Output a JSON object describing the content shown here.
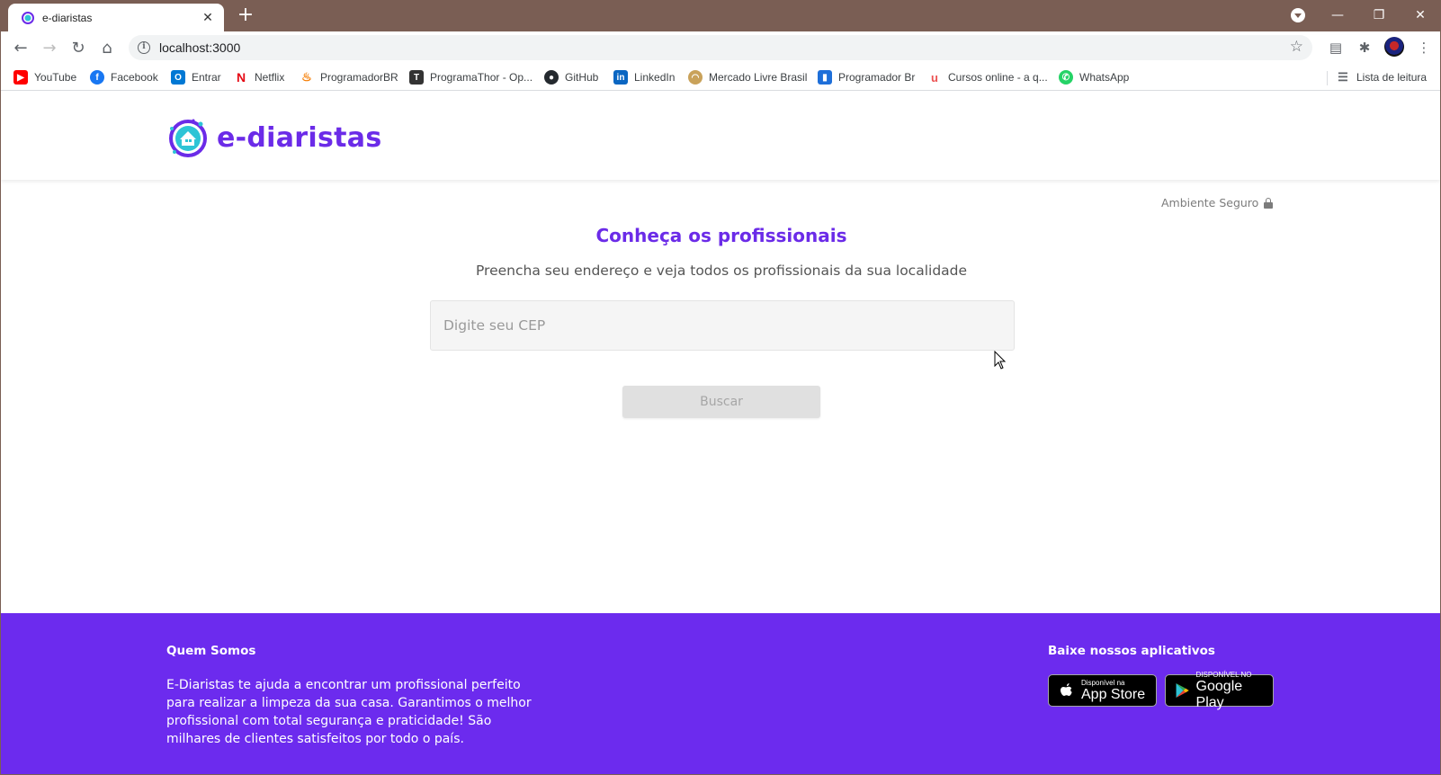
{
  "browser": {
    "tab_title": "e-diaristas",
    "url": "localhost:3000",
    "bookmarks": [
      {
        "label": "YouTube",
        "icon": "youtube-icon",
        "color": "#ff0000"
      },
      {
        "label": "Facebook",
        "icon": "facebook-icon",
        "color": "#1877f2"
      },
      {
        "label": "Entrar",
        "icon": "outlook-icon",
        "color": "#0078d4"
      },
      {
        "label": "Netflix",
        "icon": "netflix-icon",
        "color": "#e50914"
      },
      {
        "label": "ProgramadorBR",
        "icon": "flame-icon",
        "color": "#f57c00"
      },
      {
        "label": "ProgramaThor - Op...",
        "icon": "programathor-icon",
        "color": "#333333"
      },
      {
        "label": "GitHub",
        "icon": "github-icon",
        "color": "#24292e"
      },
      {
        "label": "LinkedIn",
        "icon": "linkedin-icon",
        "color": "#0a66c2"
      },
      {
        "label": "Mercado Livre Brasil",
        "icon": "mercadolivre-icon",
        "color": "#c9a25a"
      },
      {
        "label": "Programador Br",
        "icon": "programadorbr-icon",
        "color": "#1e6fd9"
      },
      {
        "label": "Cursos online - a q...",
        "icon": "udemy-icon",
        "color": "#ec5252"
      },
      {
        "label": "WhatsApp",
        "icon": "whatsapp-icon",
        "color": "#25d366"
      }
    ],
    "reading_list_label": "Lista de leitura"
  },
  "site": {
    "logo_text": "e-diaristas",
    "brand_color": "#6b2be8",
    "secure_label": "Ambiente Seguro",
    "headline": "Conheça os profissionais",
    "subline": "Preencha seu endereço e veja todos os profissionais da sua localidade",
    "cep_placeholder": "Digite seu CEP",
    "search_button": "Buscar"
  },
  "footer": {
    "background": "#6c2bee",
    "about_title": "Quem Somos",
    "about_text": "E-Diaristas te ajuda a encontrar um profissional perfeito para realizar a limpeza da sua casa. Garantimos o melhor profissional com total segurança e praticidade! São milhares de clientes satisfeitos por todo o país.",
    "apps_title": "Baixe nossos aplicativos",
    "appstore_small": "Disponível na",
    "appstore_big": "App Store",
    "googleplay_small": "DISPONÍVEL NO",
    "googleplay_big": "Google Play"
  }
}
